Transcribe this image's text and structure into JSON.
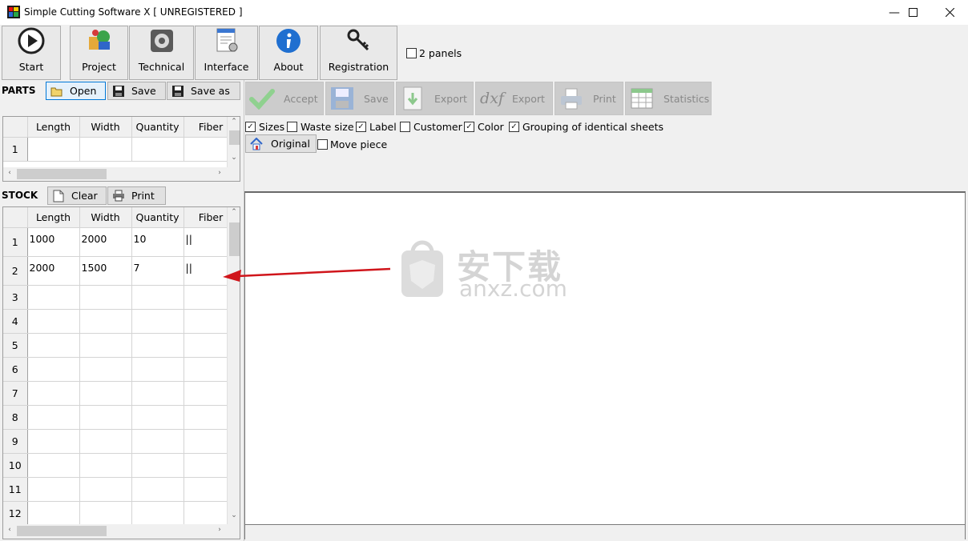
{
  "window": {
    "title": "Simple Cutting Software X [ UNREGISTERED ]"
  },
  "toolbar": {
    "start": "Start",
    "project": "Project",
    "technical": "Technical",
    "interface": "Interface",
    "about": "About",
    "registration": "Registration",
    "two_panels": "2 panels"
  },
  "parts": {
    "label": "PARTS",
    "open": "Open",
    "save": "Save",
    "save_as": "Save as",
    "columns": [
      "Length",
      "Width",
      "Quantity",
      "Fiber"
    ],
    "rows": [
      "1"
    ]
  },
  "actions": {
    "accept": "Accept",
    "save": "Save",
    "export1": "Export",
    "dxf": "dxf",
    "export2": "Export",
    "print": "Print",
    "statistics": "Statistics"
  },
  "options": {
    "sizes": "Sizes",
    "waste_size": "Waste size",
    "label": "Label",
    "customer": "Customer",
    "color": "Color",
    "grouping": "Grouping of identical sheets",
    "original": "Original",
    "move_piece": "Move piece"
  },
  "stock": {
    "label": "STOCK",
    "clear": "Clear",
    "print": "Print",
    "columns": [
      "Length",
      "Width",
      "Quantity",
      "Fiber"
    ],
    "rows": [
      {
        "n": "1",
        "length": "1000",
        "width": "2000",
        "quantity": "10",
        "fiber": "||"
      },
      {
        "n": "2",
        "length": "2000",
        "width": "1500",
        "quantity": "7",
        "fiber": "||"
      },
      {
        "n": "3"
      },
      {
        "n": "4"
      },
      {
        "n": "5"
      },
      {
        "n": "6"
      },
      {
        "n": "7"
      },
      {
        "n": "8"
      },
      {
        "n": "9"
      },
      {
        "n": "10"
      },
      {
        "n": "11"
      },
      {
        "n": "12"
      }
    ]
  },
  "watermark": {
    "text_cn": "安下载",
    "text_en": "anxz.com"
  },
  "colors": {
    "annotation_arrow": "#d0151b",
    "accept_check": "#5cb85c",
    "about_icon": "#1f6fd0"
  }
}
